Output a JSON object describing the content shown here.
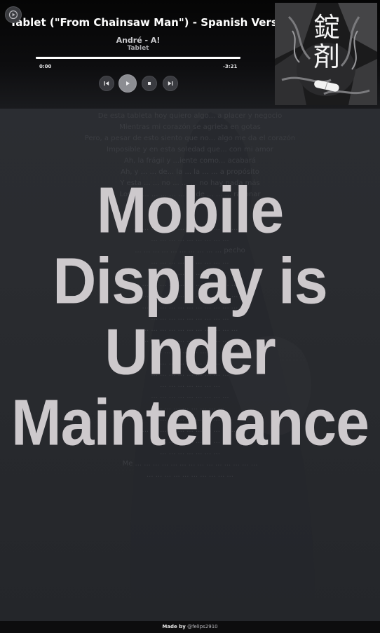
{
  "player": {
    "title": "Tablet (\"From Chainsaw Man\") - Spanish Version",
    "artist": "André - A!",
    "album": "Tablet",
    "current_time": "0:00",
    "remaining_time": "-3:21",
    "progress": 1.0,
    "cover_kanji": "錠剤"
  },
  "lyrics": [
    "De esta tableta hoy quiero algo... a placer y negocio",
    "Mientras mi corazón se agrieta en gotas",
    "Pero, a pesar de esto siento que no... algo me da el corazón",
    "Imposible y en esta soledad que... con mi amor",
    "Ah, la frágil y ...iente como... acabará",
    "Ah, y ... ... de... la ... la ... ... a propósito",
    "Y esta ... ... no ... ... ... no hay nada más",
    "Los ... ... ... ... ... ... ... de ... ... ... razonar",
    "",
    "",
    "... ... ... ... ... ... ... ... ... ... ... ... ...",
    "... ... ... ... ... ... ... ... ...",
    "... ... ... ... ... ... ... ... ... ... pecho",
    "... ... ... ... ... ... ... ... ...",
    "... ... ... ... ... ... ...",
    "... ... ... ... ... ... ... ... ... ... ...",
    "... ... ... ... ... ... ... ... ... ... ...",
    "... ... ... ... ... ... ... ... ... ... ...",
    "... ... ... ... ... ... ... ... ...",
    "... ... ... ... ... ... ... ... ... ... ...",
    "... ... ... ... ... ... ... ... ... ... ...",
    "... ... ... ... ... ... ... ...",
    "... ... ... ... ... ... ...",
    "... ... ... ... ... ... ... ... ...",
    "... ... ... ... ... ... ...",
    "... ... ... ... ... ... ... ... ...",
    "... ... ... ... ... ... ... ...",
    "... ... ... ... ... ... ... ... ...",
    "... ... ... ... ... ... ... ... ... ... ...",
    "... ... ... ... ... ... ... ... ...",
    "... ... ... ... ... ... ...",
    "Me ... ... ... ... ... ... ... ... ... ... ... ... ... ...",
    "... ... ... ... ... ... ... ... ... ..."
  ],
  "overlay": {
    "lines": [
      "Mobile",
      "Display is",
      "Under",
      "Maintenance"
    ]
  },
  "footer": {
    "made_by": "Made by",
    "handle": "@felips2910"
  },
  "colors": {
    "background": "#2a2c30",
    "header": "#0d0d0f",
    "overlay_text": "#cdc9cc",
    "play_button": "#8c8d92"
  }
}
